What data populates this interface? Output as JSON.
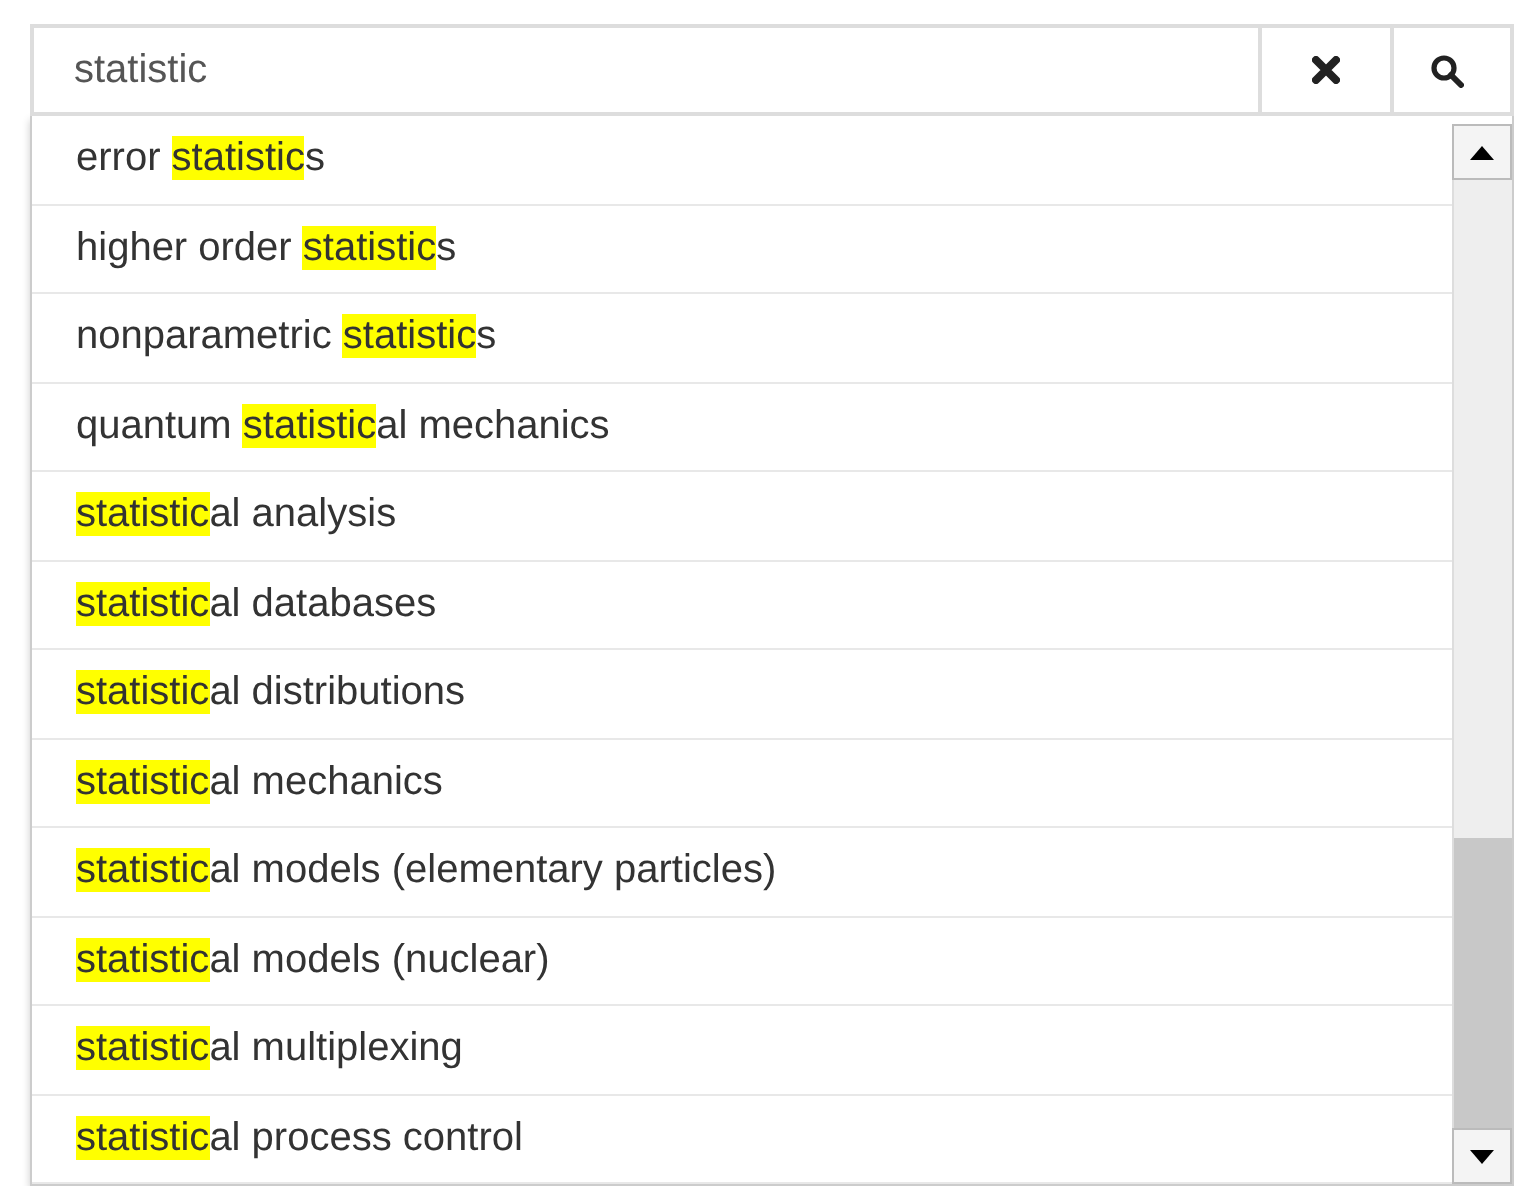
{
  "search": {
    "value": "statistic"
  },
  "buttons": [
    {
      "kind": "clear"
    },
    {
      "kind": "search"
    }
  ],
  "suggestions": [
    {
      "before": "error ",
      "match": "statistic",
      "after": "s"
    },
    {
      "before": "higher order ",
      "match": "statistic",
      "after": "s"
    },
    {
      "before": "nonparametric ",
      "match": "statistic",
      "after": "s"
    },
    {
      "before": "quantum ",
      "match": "statistic",
      "after": "al mechanics"
    },
    {
      "match": "statistic",
      "after": "al analysis"
    },
    {
      "match": "statistic",
      "after": "al databases"
    },
    {
      "match": "statistic",
      "after": "al distributions"
    },
    {
      "match": "statistic",
      "after": "al mechanics"
    },
    {
      "match": "statistic",
      "after": "al models (elementary particles)"
    },
    {
      "match": "statistic",
      "after": "al models (nuclear)"
    },
    {
      "match": "statistic",
      "after": "al multiplexing"
    },
    {
      "match": "statistic",
      "after": "al process control"
    }
  ]
}
